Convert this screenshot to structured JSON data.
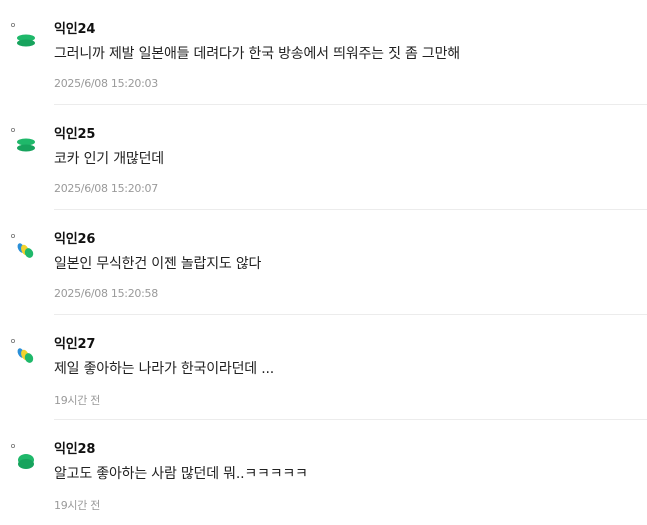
{
  "comments": [
    {
      "author": "익인24",
      "text": "그러니까 제발 일본애들 데려다가 한국 방송에서 띄워주는 짓 좀 그만해",
      "time": "2025/6/08 15:20:03",
      "avatar_icon": "green-stack-avatar-icon"
    },
    {
      "author": "익인25",
      "text": "코카 인기 개많던데",
      "time": "2025/6/08 15:20:07",
      "avatar_icon": "green-stack-avatar-icon"
    },
    {
      "author": "익인26",
      "text": "일본인 무식한건 이젠 놀랍지도 않다",
      "time": "2025/6/08 15:20:58",
      "avatar_icon": "blue-yellow-green-avatar-icon"
    },
    {
      "author": "익인27",
      "text": "제일 좋아하는 나라가 한국이라던데 ...",
      "time": "19시간 전",
      "avatar_icon": "blue-yellow-green-avatar-icon"
    },
    {
      "author": "익인28",
      "text": "알고도 좋아하는 사람 많던데 뭐..ㅋㅋㅋㅋㅋ",
      "time": "19시간 전",
      "avatar_icon": "green-circle-avatar-icon"
    }
  ],
  "colors": {
    "avatar_green": "#1fb86a",
    "avatar_blue": "#2a8fd8",
    "avatar_yellow": "#f2d22e",
    "timestamp_gray": "#9a9a9a",
    "divider": "#ececec"
  }
}
